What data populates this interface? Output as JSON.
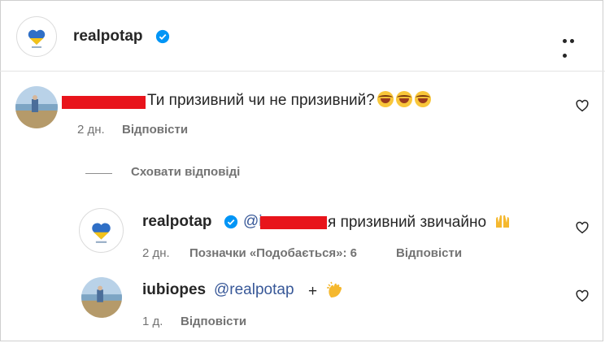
{
  "header": {
    "username": "realpotap",
    "more_label": "•••"
  },
  "comments": [
    {
      "text": "Ти призивний чи не призивний?",
      "time": "2 дн.",
      "reply_label": "Відповісти"
    }
  ],
  "hide_replies_label": "Сховати відповіді",
  "replies": [
    {
      "username": "realpotap",
      "mention_prefix": "@i",
      "text": "я призивний звичайно",
      "time": "2 дн.",
      "likes_label": "Позначки «Подобається»: 6",
      "reply_label": "Відповісти"
    },
    {
      "username": "iubiopes",
      "mention": "@realpotap",
      "text": "+",
      "time": "1 д.",
      "reply_label": "Відповісти"
    }
  ],
  "icons": [
    "verified-badge-icon",
    "heart-icon",
    "more-icon",
    "laugh-emoji-icon",
    "raised-hands-emoji-icon",
    "clap-emoji-icon"
  ],
  "colors": {
    "badge": "#0095f6",
    "redaction": "#e8141b",
    "muted": "#737373",
    "mention": "#385898"
  }
}
